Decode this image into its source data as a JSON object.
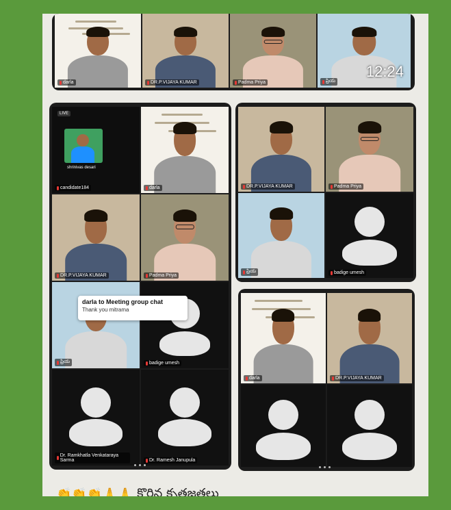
{
  "card1": {
    "time": "12:24",
    "tiles": [
      {
        "name": "darla"
      },
      {
        "name": "DR.P.VIJAYA KUMAR"
      },
      {
        "name": "Padma Priya"
      },
      {
        "name": "ప్రియ"
      }
    ]
  },
  "card2": {
    "live": "LIVE",
    "self_name": "shrinivas desari",
    "tiles": [
      {
        "name": "candidate184"
      },
      {
        "name": "darla"
      },
      {
        "name": "DR.P.VIJAYA KUMAR"
      },
      {
        "name": "Padma Priya"
      },
      {
        "name": "ప్రియ"
      },
      {
        "name": "badige umesh"
      },
      {
        "name": "Dr. Ramkhatla Venkataraya Sarma"
      },
      {
        "name": "Dr. Ramesh Janupula"
      }
    ],
    "chat": {
      "title": "darla to Meeting group chat",
      "message": "Thank you mitrama"
    }
  },
  "card3": {
    "tiles": [
      {
        "name": "DR.P.VIJAYA KUMAR"
      },
      {
        "name": "Padma Priya"
      },
      {
        "name": "ప్రియ"
      },
      {
        "name": "badige umesh"
      }
    ]
  },
  "card4": {
    "tiles": [
      {
        "name": "darla"
      },
      {
        "name": "DR.P.VIJAYA KUMAR"
      }
    ]
  },
  "footer": {
    "emojis": "👏👏👏🙏🙏",
    "text": "కొరిన కృతజ్ఞతలు"
  }
}
